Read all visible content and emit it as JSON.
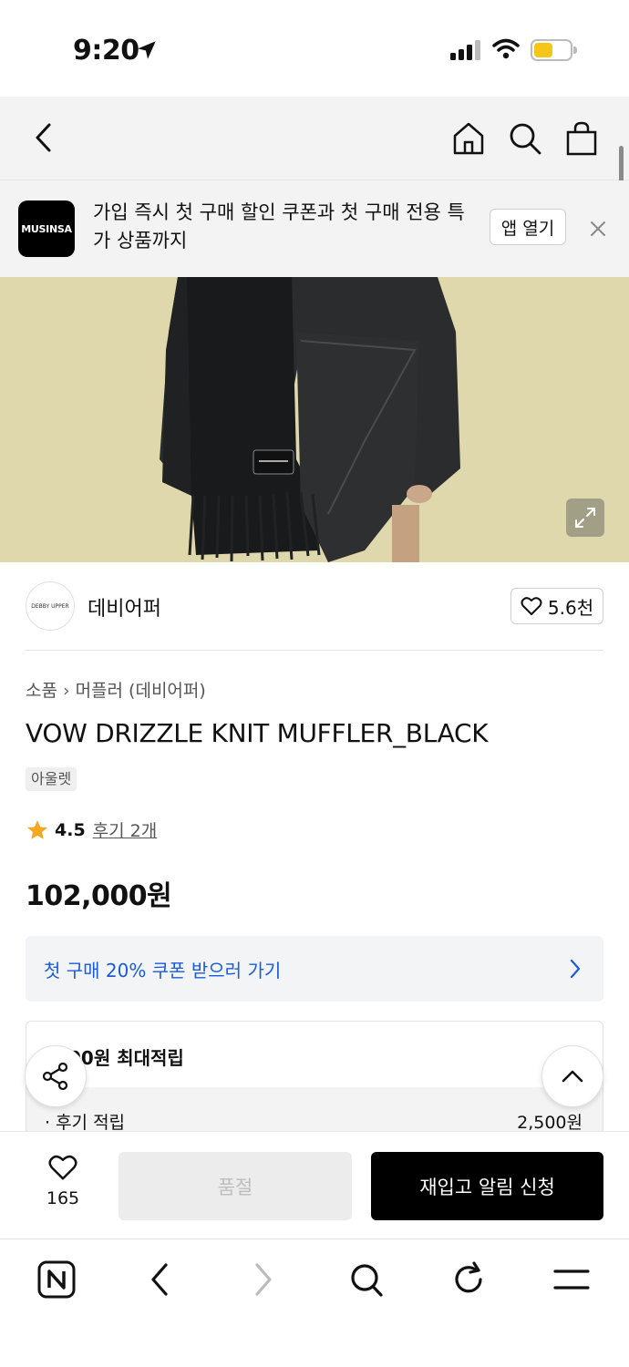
{
  "status_bar": {
    "time": "9:20"
  },
  "banner": {
    "logo_text": "MUSINSA",
    "message": "가입 즉시 첫 구매 할인 쿠폰과 첫 구매 전용 특가 상품까지",
    "open_label": "앱 열기"
  },
  "brand": {
    "logo_text": "DEBBY UPPER",
    "name": "데비어퍼",
    "likes": "5.6천"
  },
  "breadcrumb": {
    "category": "소품",
    "sub": "머플러 (데비어퍼)"
  },
  "product": {
    "title": "VOW DRIZZLE KNIT MUFFLER_BLACK",
    "tag": "아울렛",
    "rating": "4.5",
    "reviews": "후기 2개",
    "price": "102,000원"
  },
  "coupon": {
    "label": "첫 구매 20% 쿠폰 받으러 가기"
  },
  "points": {
    "header": "00원 최대적립",
    "row_label": "· 후기 적립",
    "row_value": "2,500원"
  },
  "action_bar": {
    "wish_count": "165",
    "soldout_label": "품절",
    "restock_label": "재입고 알림 신청"
  },
  "colors": {
    "accent_blue": "#1a5bd9",
    "star": "#f5a623",
    "battery": "#f5c518"
  }
}
